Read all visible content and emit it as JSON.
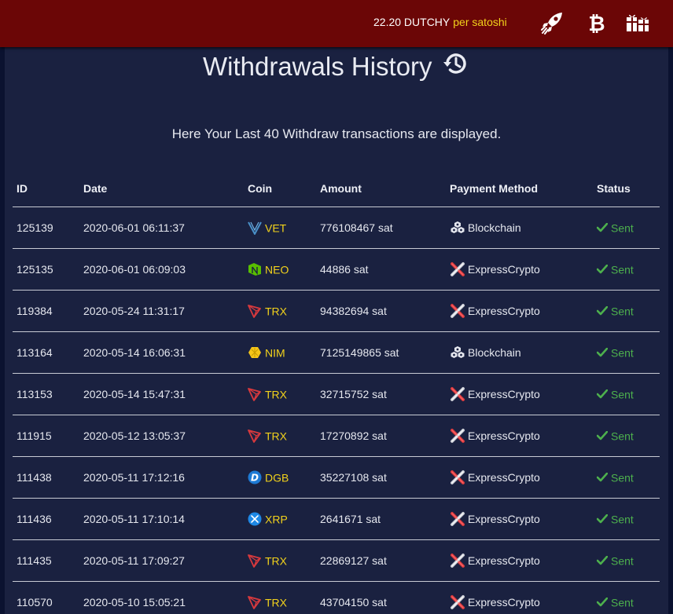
{
  "header": {
    "rate_value": "22.20 DUTCHY",
    "rate_unit": "per satoshi",
    "icons": [
      "rocket-icon",
      "bitcoin-icon",
      "gift-boxes-icon"
    ]
  },
  "page": {
    "title": "Withdrawals History",
    "title_icon": "history-icon",
    "subtitle": "Here Your Last 40 Withdraw transactions are displayed."
  },
  "table": {
    "columns": [
      "ID",
      "Date",
      "Coin",
      "Amount",
      "Payment Method",
      "Status"
    ],
    "rows": [
      {
        "id": "125139",
        "date": "2020-06-01 06:11:37",
        "coin": "VET",
        "coin_icon": "vet-icon",
        "amount": "776108467 sat",
        "method": "Blockchain",
        "method_icon": "blockchain-icon",
        "status": "Sent"
      },
      {
        "id": "125135",
        "date": "2020-06-01 06:09:03",
        "coin": "NEO",
        "coin_icon": "neo-icon",
        "amount": "44886 sat",
        "method": "ExpressCrypto",
        "method_icon": "expresscrypto-icon",
        "status": "Sent"
      },
      {
        "id": "119384",
        "date": "2020-05-24 11:31:17",
        "coin": "TRX",
        "coin_icon": "trx-icon",
        "amount": "94382694 sat",
        "method": "ExpressCrypto",
        "method_icon": "expresscrypto-icon",
        "status": "Sent"
      },
      {
        "id": "113164",
        "date": "2020-05-14 16:06:31",
        "coin": "NIM",
        "coin_icon": "nim-icon",
        "amount": "7125149865 sat",
        "method": "Blockchain",
        "method_icon": "blockchain-icon",
        "status": "Sent"
      },
      {
        "id": "113153",
        "date": "2020-05-14 15:47:31",
        "coin": "TRX",
        "coin_icon": "trx-icon",
        "amount": "32715752 sat",
        "method": "ExpressCrypto",
        "method_icon": "expresscrypto-icon",
        "status": "Sent"
      },
      {
        "id": "111915",
        "date": "2020-05-12 13:05:37",
        "coin": "TRX",
        "coin_icon": "trx-icon",
        "amount": "17270892 sat",
        "method": "ExpressCrypto",
        "method_icon": "expresscrypto-icon",
        "status": "Sent"
      },
      {
        "id": "111438",
        "date": "2020-05-11 17:12:16",
        "coin": "DGB",
        "coin_icon": "dgb-icon",
        "amount": "35227108 sat",
        "method": "ExpressCrypto",
        "method_icon": "expresscrypto-icon",
        "status": "Sent"
      },
      {
        "id": "111436",
        "date": "2020-05-11 17:10:14",
        "coin": "XRP",
        "coin_icon": "xrp-icon",
        "amount": "2641671 sat",
        "method": "ExpressCrypto",
        "method_icon": "expresscrypto-icon",
        "status": "Sent"
      },
      {
        "id": "111435",
        "date": "2020-05-11 17:09:27",
        "coin": "TRX",
        "coin_icon": "trx-icon",
        "amount": "22869127 sat",
        "method": "ExpressCrypto",
        "method_icon": "expresscrypto-icon",
        "status": "Sent"
      },
      {
        "id": "110570",
        "date": "2020-05-10 15:05:21",
        "coin": "TRX",
        "coin_icon": "trx-icon",
        "amount": "43704150 sat",
        "method": "ExpressCrypto",
        "method_icon": "expresscrypto-icon",
        "status": "Sent"
      }
    ]
  },
  "colors": {
    "topbar": "#6b0606",
    "page_bg": "#1a2140",
    "coin_text": "#f2d21b",
    "status_sent": "#4db04d"
  }
}
